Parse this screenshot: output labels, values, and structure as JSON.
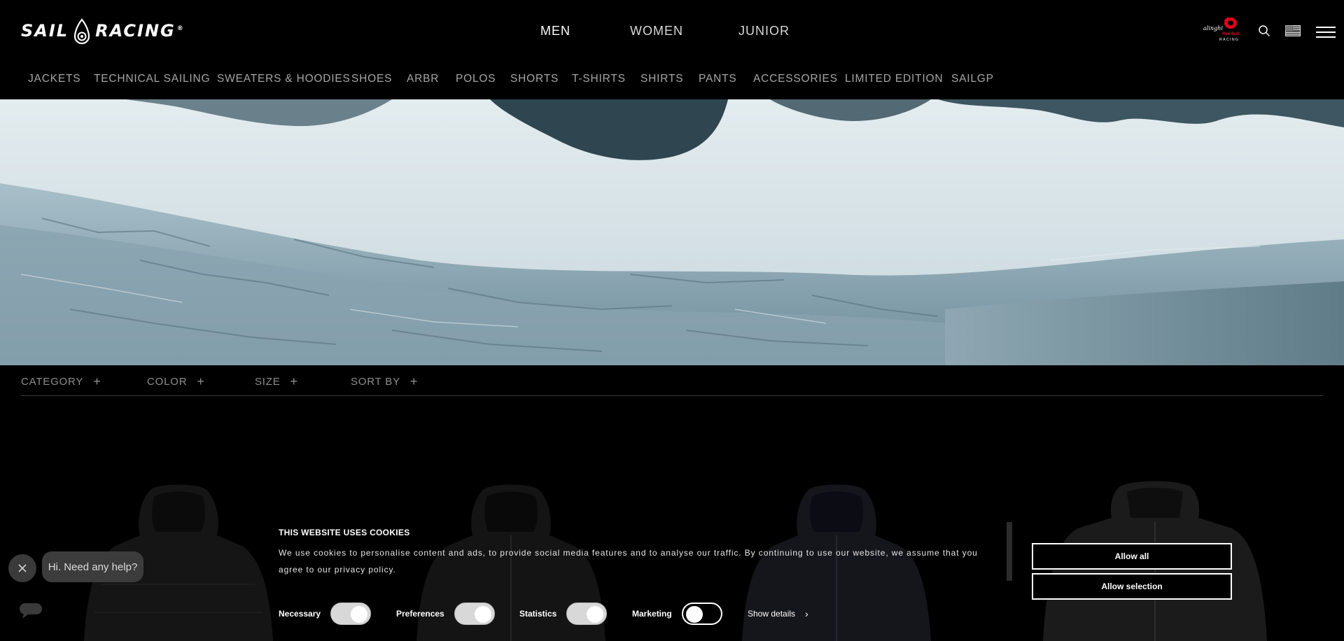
{
  "header": {
    "brand": "SAIL RACING",
    "sponsor_logo_text": [
      "alinghi",
      "Red Bull",
      "RACING"
    ],
    "gender_nav": [
      {
        "label": "MEN",
        "active": true
      },
      {
        "label": "WOMEN",
        "active": false
      },
      {
        "label": "JUNIOR",
        "active": false
      }
    ],
    "icons": [
      "search-icon",
      "flag-icon",
      "menu-icon"
    ]
  },
  "category_nav": [
    "JACKETS",
    "TECHNICAL SAILING",
    "SWEATERS & HOODIES",
    "SHOES",
    "ARBR",
    "POLOS",
    "SHORTS",
    "T-SHIRTS",
    "SHIRTS",
    "PANTS",
    "ACCESSORIES",
    "LIMITED EDITION",
    "SAILGP"
  ],
  "filters": [
    {
      "label": "CATEGORY"
    },
    {
      "label": "COLOR"
    },
    {
      "label": "SIZE"
    },
    {
      "label": "SORT BY"
    }
  ],
  "chat": {
    "bubble_text": "Hi. Need any help?"
  },
  "cookie_banner": {
    "title": "THIS WEBSITE USES COOKIES",
    "text": "We use cookies to personalise content and ads, to provide social media features and to analyse our traffic. By continuing to use our website, we assume that you agree to our privacy policy.",
    "consents": [
      {
        "label": "Necessary",
        "checked": true
      },
      {
        "label": "Preferences",
        "checked": true
      },
      {
        "label": "Statistics",
        "checked": true
      },
      {
        "label": "Marketing",
        "checked": false
      }
    ],
    "show_details": "Show details",
    "allow_all": "Allow all",
    "allow_selection": "Allow selection"
  },
  "colors": {
    "background": "#000000",
    "nav_text": "#a6a6a6",
    "glacier": "#9fb7c2",
    "sponsor_red": "#e2001a"
  }
}
